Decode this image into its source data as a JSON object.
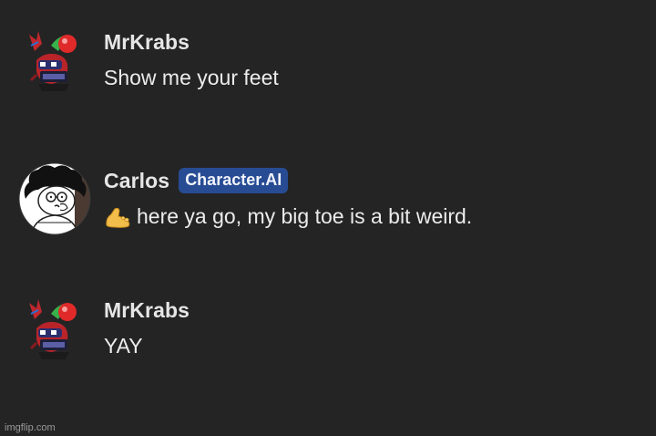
{
  "messages": [
    {
      "author": "MrKrabs",
      "avatar_icon": "mr-krabs-avatar-icon",
      "text": "Show me your feet"
    },
    {
      "author": "Carlos",
      "badge": "Character.AI",
      "avatar_icon": "carlos-avatar-icon",
      "emoji_icon": "foot-emoji-icon",
      "text": "here ya go, my big toe is a bit weird."
    },
    {
      "author": "MrKrabs",
      "avatar_icon": "mr-krabs-avatar-icon",
      "text": "YAY"
    }
  ],
  "watermark": "imgflip.com",
  "colors": {
    "background": "#242424",
    "badge_bg": "#274c94",
    "text": "#ececec"
  }
}
